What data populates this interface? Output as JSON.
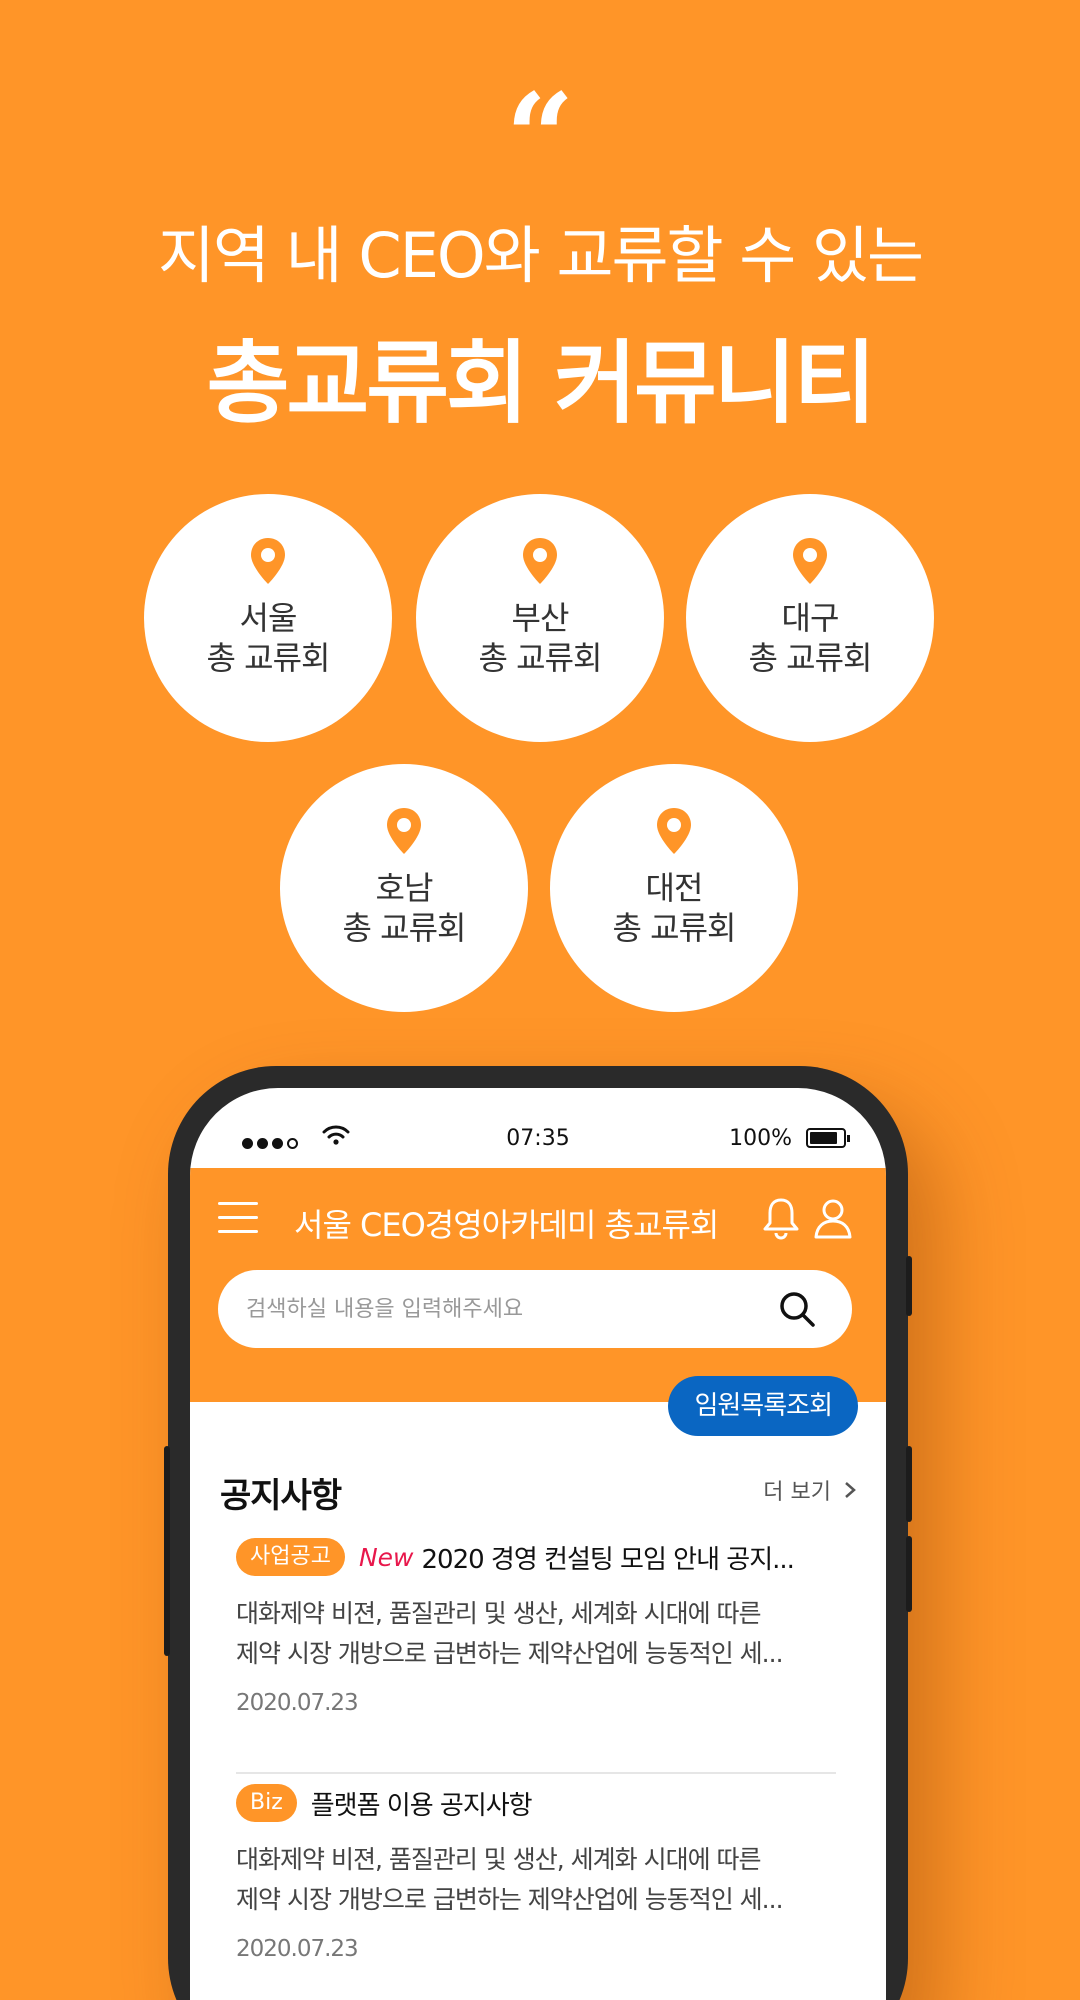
{
  "hero": {
    "quote": "“",
    "subtitle": "지역 내 CEO와 교류할 수 있는",
    "title": "총교류회 커뮤니티"
  },
  "regions": [
    {
      "name": "서울",
      "sub": "총 교류회"
    },
    {
      "name": "부산",
      "sub": "총 교류회"
    },
    {
      "name": "대구",
      "sub": "총 교류회"
    },
    {
      "name": "호남",
      "sub": "총 교류회"
    },
    {
      "name": "대전",
      "sub": "총 교류회"
    }
  ],
  "status": {
    "time": "07:35",
    "battery": "100%"
  },
  "app": {
    "title": "서울 CEO경영아카데미 총교류회",
    "search_placeholder": "검색하실 내용을 입력해주세요",
    "exec_button": "임원목록조회"
  },
  "notices": {
    "section_title": "공지사항",
    "more": "더 보기",
    "items": [
      {
        "tag": "사업공고",
        "new": "New",
        "title": "2020 경영 컨설팅 모임 안내 공지...",
        "body1": "대화제약 비젼, 품질관리 및 생산, 세계화 시대에 따른",
        "body2": "제약 시장 개방으로 급변하는 제약산업에 능동적인 세...",
        "date": "2020.07.23"
      },
      {
        "tag": "Biz",
        "title": "플랫폼 이용 공지사항",
        "body1": "대화제약 비젼, 품질관리 및 생산, 세계화 시대에 따른",
        "body2": "제약 시장 개방으로 급변하는 제약산업에 능동적인 세...",
        "date": "2020.07.23"
      }
    ]
  },
  "colors": {
    "accent": "#FF9528",
    "button_blue": "#0A66C2",
    "new_red": "#E8174B"
  },
  "icons": [
    "map-pin-icon",
    "menu-icon",
    "bell-icon",
    "user-icon",
    "search-icon",
    "chevron-right-icon",
    "wifi-icon",
    "battery-icon"
  ]
}
